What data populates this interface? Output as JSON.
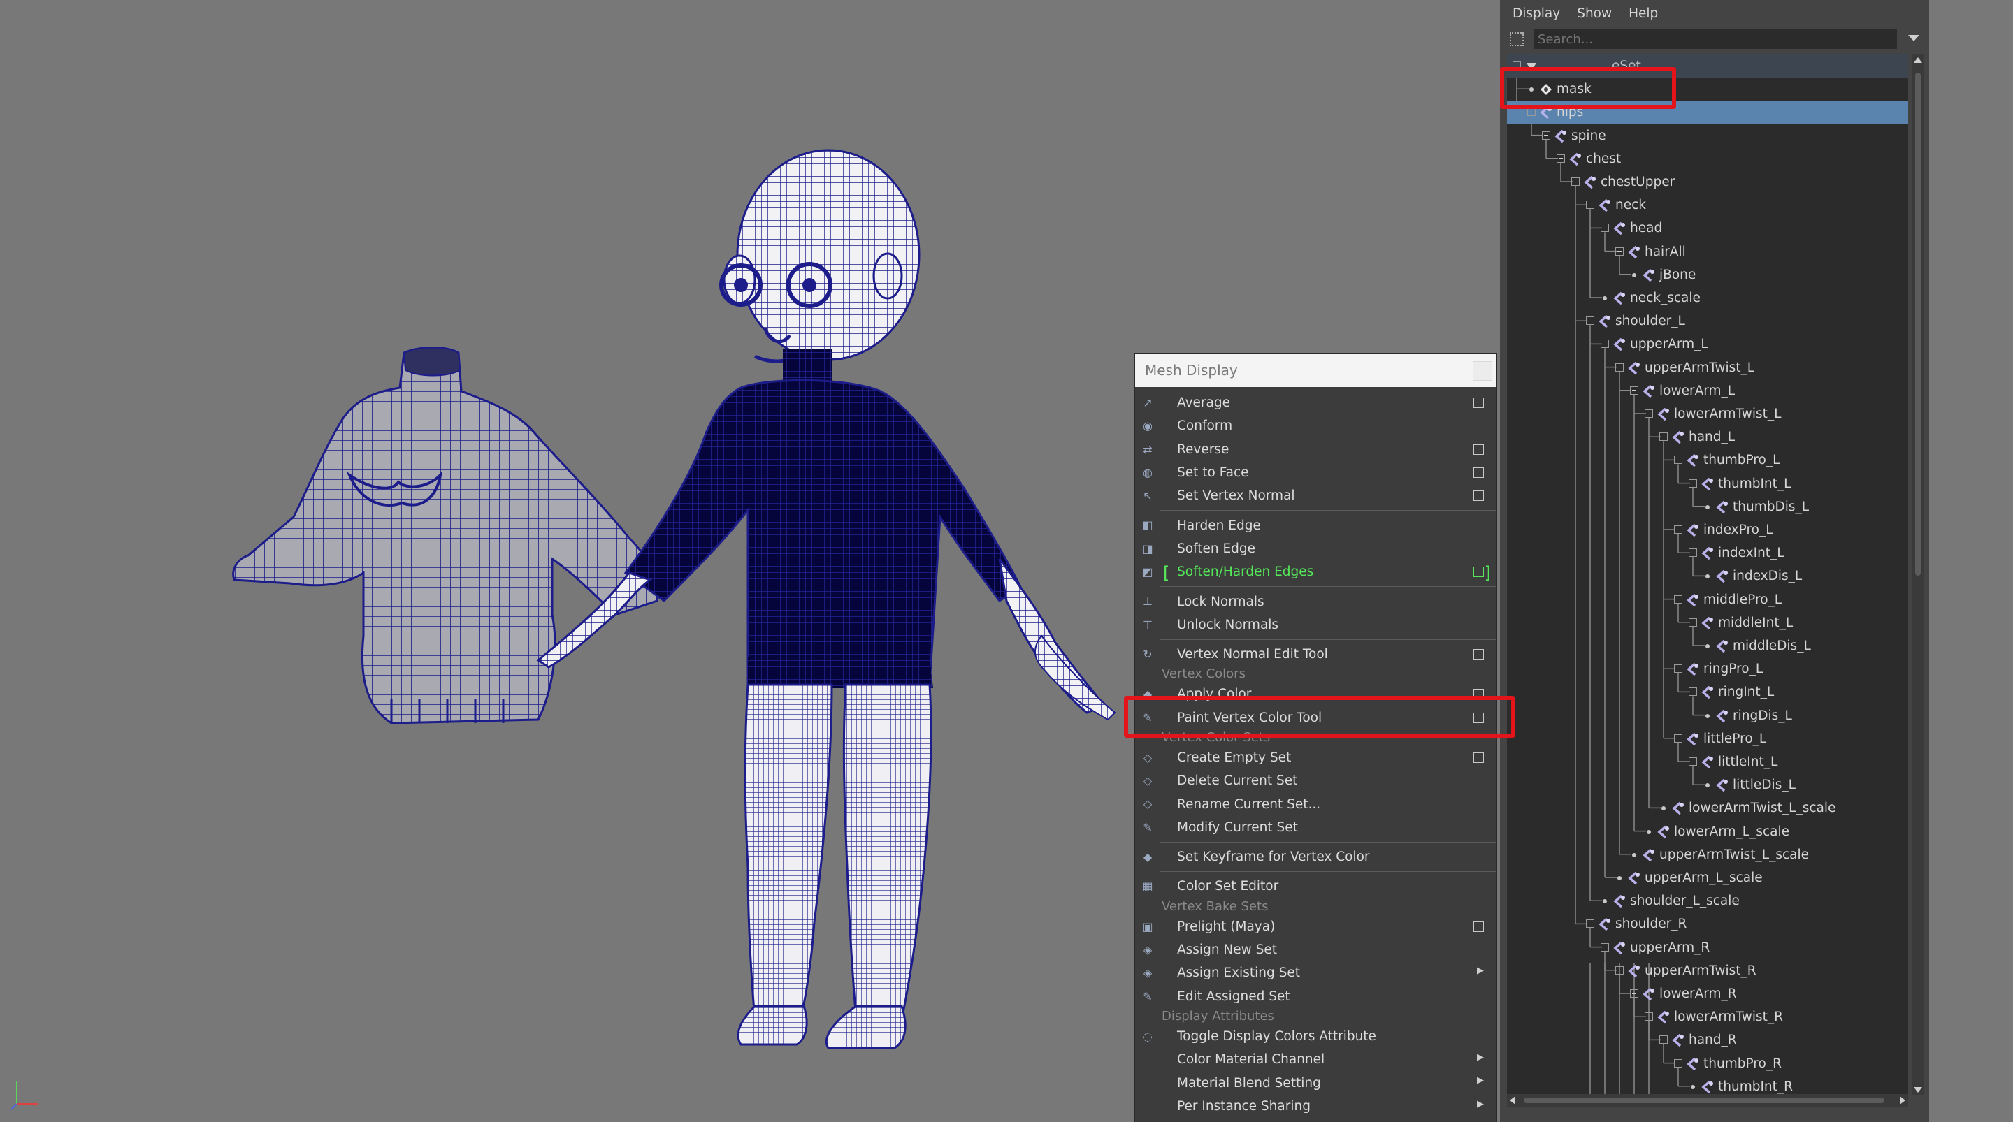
{
  "viewport": {
    "mesh_color": "#1c1c8a",
    "background": "#787878"
  },
  "mesh_display_menu": {
    "title": "Mesh Display",
    "sections": [
      {
        "header": "",
        "items": [
          {
            "label": "Average",
            "icon": "average-normals-icon",
            "option_box": true
          },
          {
            "label": "Conform",
            "icon": "conform-icon",
            "option_box": false
          },
          {
            "label": "Reverse",
            "icon": "reverse-icon",
            "option_box": true
          },
          {
            "label": "Set to Face",
            "icon": "set-to-face-icon",
            "option_box": true
          },
          {
            "label": "Set Vertex Normal",
            "icon": "set-vertex-normal-icon",
            "option_box": true
          }
        ]
      },
      {
        "header": "",
        "items": [
          {
            "label": "Harden Edge",
            "icon": "harden-edge-icon",
            "option_box": false
          },
          {
            "label": "Soften Edge",
            "icon": "soften-edge-icon",
            "option_box": false
          },
          {
            "label": "Soften/Harden Edges",
            "icon": "soften-harden-icon",
            "option_box": true,
            "highlighted": true
          }
        ]
      },
      {
        "header": "",
        "items": [
          {
            "label": "Lock Normals",
            "icon": "lock-normals-icon",
            "option_box": false
          },
          {
            "label": "Unlock Normals",
            "icon": "unlock-normals-icon",
            "option_box": false
          }
        ]
      },
      {
        "header": "",
        "items": [
          {
            "label": "Vertex Normal Edit Tool",
            "icon": "vertex-normal-edit-icon",
            "option_box": true
          }
        ]
      },
      {
        "header": "Vertex Colors",
        "items": [
          {
            "label": "Apply Color",
            "icon": "apply-color-icon",
            "option_box": true
          },
          {
            "label": "Paint Vertex Color Tool",
            "icon": "paint-brush-icon",
            "option_box": true,
            "annotated": true
          }
        ]
      },
      {
        "header": "Vertex Color Sets",
        "items": [
          {
            "label": "Create Empty Set",
            "icon": "create-set-icon",
            "option_box": true
          },
          {
            "label": "Delete Current Set",
            "icon": "delete-set-icon",
            "option_box": false
          },
          {
            "label": "Rename Current Set...",
            "icon": "rename-set-icon",
            "option_box": false
          },
          {
            "label": "Modify Current Set",
            "icon": "modify-set-icon",
            "option_box": false
          }
        ]
      },
      {
        "header": "",
        "items": [
          {
            "label": "Set Keyframe for Vertex Color",
            "icon": "keyframe-icon",
            "option_box": false
          }
        ]
      },
      {
        "header": "",
        "items": [
          {
            "label": "Color Set Editor",
            "icon": "color-set-editor-icon",
            "option_box": false
          }
        ]
      },
      {
        "header": "Vertex Bake Sets",
        "items": [
          {
            "label": "Prelight (Maya)",
            "icon": "prelight-icon",
            "option_box": true
          },
          {
            "label": "Assign New Set",
            "icon": "assign-new-icon",
            "option_box": false
          },
          {
            "label": "Assign Existing Set",
            "icon": "assign-existing-icon",
            "submenu": true
          },
          {
            "label": "Edit Assigned Set",
            "icon": "edit-assigned-icon",
            "option_box": false
          }
        ]
      },
      {
        "header": "Display Attributes",
        "items": [
          {
            "label": "Toggle Display Colors Attribute",
            "icon": "toggle-display-icon",
            "option_box": false
          },
          {
            "label": "Color Material Channel",
            "icon": "",
            "submenu": true
          },
          {
            "label": "Material Blend Setting",
            "icon": "",
            "submenu": true
          },
          {
            "label": "Per Instance Sharing",
            "icon": "",
            "submenu": true
          }
        ]
      }
    ]
  },
  "outliner": {
    "menu": [
      "Display",
      "Show",
      "Help"
    ],
    "search_placeholder": "Search...",
    "tree": [
      {
        "label": "",
        "depth": 0,
        "icon": "quickselect-set-icon",
        "partially_hidden_suffix": "eSet"
      },
      {
        "label": "mask",
        "depth": 1,
        "icon": "mesh-transform-icon"
      },
      {
        "label": "hips",
        "depth": 1,
        "icon": "joint-icon",
        "selected": true
      },
      {
        "label": "spine",
        "depth": 2,
        "icon": "joint-icon"
      },
      {
        "label": "chest",
        "depth": 3,
        "icon": "joint-icon"
      },
      {
        "label": "chestUpper",
        "depth": 4,
        "icon": "joint-icon"
      },
      {
        "label": "neck",
        "depth": 5,
        "icon": "joint-icon"
      },
      {
        "label": "head",
        "depth": 6,
        "icon": "joint-icon"
      },
      {
        "label": "hairAll",
        "depth": 7,
        "icon": "joint-icon"
      },
      {
        "label": "jBone",
        "depth": 8,
        "icon": "joint-icon"
      },
      {
        "label": "neck_scale",
        "depth": 6,
        "icon": "joint-icon"
      },
      {
        "label": "shoulder_L",
        "depth": 5,
        "icon": "joint-icon"
      },
      {
        "label": "upperArm_L",
        "depth": 6,
        "icon": "joint-icon"
      },
      {
        "label": "upperArmTwist_L",
        "depth": 7,
        "icon": "joint-icon"
      },
      {
        "label": "lowerArm_L",
        "depth": 8,
        "icon": "joint-icon"
      },
      {
        "label": "lowerArmTwist_L",
        "depth": 9,
        "icon": "joint-icon"
      },
      {
        "label": "hand_L",
        "depth": 10,
        "icon": "joint-icon"
      },
      {
        "label": "thumbPro_L",
        "depth": 11,
        "icon": "joint-icon"
      },
      {
        "label": "thumbInt_L",
        "depth": 12,
        "icon": "joint-icon"
      },
      {
        "label": "thumbDis_L",
        "depth": 13,
        "icon": "joint-icon"
      },
      {
        "label": "indexPro_L",
        "depth": 11,
        "icon": "joint-icon"
      },
      {
        "label": "indexInt_L",
        "depth": 12,
        "icon": "joint-icon"
      },
      {
        "label": "indexDis_L",
        "depth": 13,
        "icon": "joint-icon"
      },
      {
        "label": "middlePro_L",
        "depth": 11,
        "icon": "joint-icon"
      },
      {
        "label": "middleInt_L",
        "depth": 12,
        "icon": "joint-icon"
      },
      {
        "label": "middleDis_L",
        "depth": 13,
        "icon": "joint-icon"
      },
      {
        "label": "ringPro_L",
        "depth": 11,
        "icon": "joint-icon"
      },
      {
        "label": "ringInt_L",
        "depth": 12,
        "icon": "joint-icon"
      },
      {
        "label": "ringDis_L",
        "depth": 13,
        "icon": "joint-icon"
      },
      {
        "label": "littlePro_L",
        "depth": 11,
        "icon": "joint-icon"
      },
      {
        "label": "littleInt_L",
        "depth": 12,
        "icon": "joint-icon"
      },
      {
        "label": "littleDis_L",
        "depth": 13,
        "icon": "joint-icon"
      },
      {
        "label": "lowerArmTwist_L_scale",
        "depth": 10,
        "icon": "joint-icon"
      },
      {
        "label": "lowerArm_L_scale",
        "depth": 9,
        "icon": "joint-icon"
      },
      {
        "label": "upperArmTwist_L_scale",
        "depth": 8,
        "icon": "joint-icon"
      },
      {
        "label": "upperArm_L_scale",
        "depth": 7,
        "icon": "joint-icon"
      },
      {
        "label": "shoulder_L_scale",
        "depth": 6,
        "icon": "joint-icon"
      },
      {
        "label": "shoulder_R",
        "depth": 5,
        "icon": "joint-icon"
      },
      {
        "label": "upperArm_R",
        "depth": 6,
        "icon": "joint-icon"
      },
      {
        "label": "upperArmTwist_R",
        "depth": 7,
        "icon": "joint-icon"
      },
      {
        "label": "lowerArm_R",
        "depth": 8,
        "icon": "joint-icon"
      },
      {
        "label": "lowerArmTwist_R",
        "depth": 9,
        "icon": "joint-icon"
      },
      {
        "label": "hand_R",
        "depth": 10,
        "icon": "joint-icon"
      },
      {
        "label": "thumbPro_R",
        "depth": 11,
        "icon": "joint-icon"
      },
      {
        "label": "thumbInt_R",
        "depth": 12,
        "icon": "joint-icon"
      }
    ]
  },
  "colors": {
    "annotation_red": "#e5141a",
    "selection_blue": "#5a84ad",
    "menu_highlight_green": "#55e85a"
  }
}
